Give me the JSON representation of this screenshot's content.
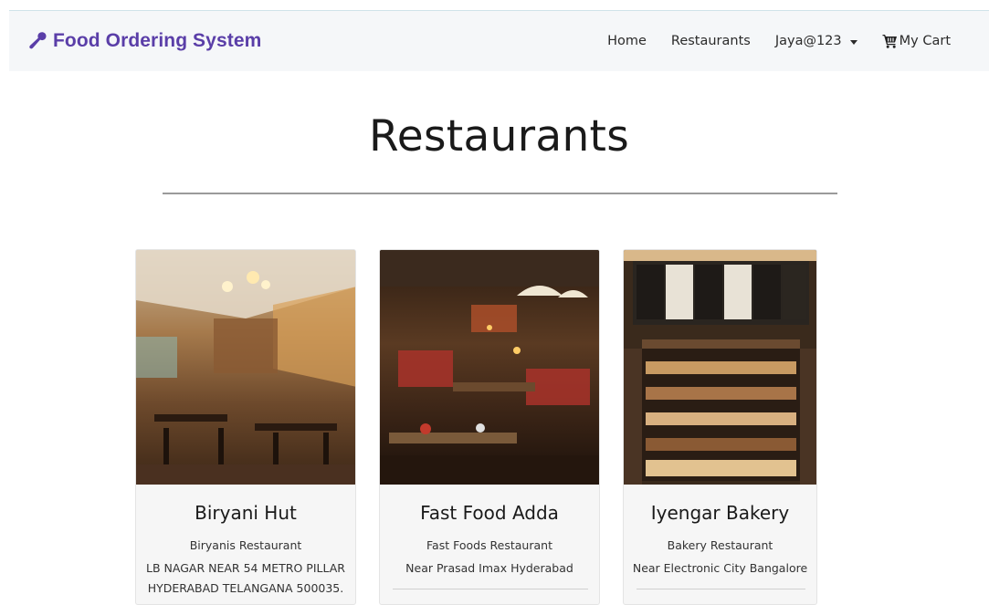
{
  "navbar": {
    "brand": "Food Ordering System",
    "links": [
      "Home",
      "Restaurants"
    ],
    "user": "Jaya@123",
    "cart": "My Cart",
    "brand_color": "#5a3ea8"
  },
  "page": {
    "title": "Restaurants"
  },
  "restaurants": [
    {
      "name": "Biryani Hut",
      "type": "Biryanis Restaurant",
      "address_lines": [
        "LB NAGAR NEAR 54 METRO PILLAR",
        "HYDERABAD TELANGANA 500035."
      ]
    },
    {
      "name": "Fast Food Adda",
      "type": "Fast Foods Restaurant",
      "address_lines": [
        "Near Prasad Imax Hyderabad"
      ]
    },
    {
      "name": "Iyengar Bakery",
      "type": "Bakery Restaurant",
      "address_lines": [
        "Near Electronic City Bangalore"
      ]
    }
  ],
  "icons": {
    "brand": "wrench-icon",
    "cart": "cart-icon",
    "dropdown": "caret-down-icon"
  }
}
